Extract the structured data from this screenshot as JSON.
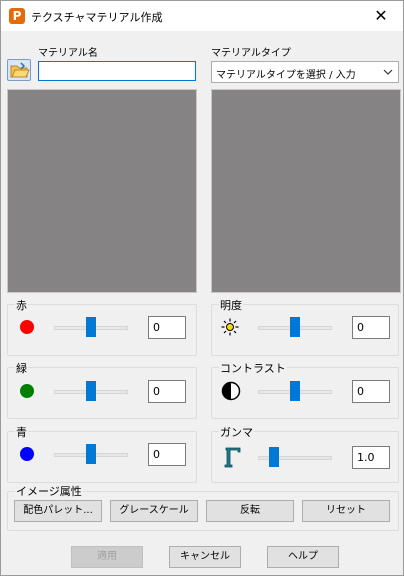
{
  "window": {
    "title": "テクスチャマテリアル作成",
    "close_glyph": "✕"
  },
  "material_name": {
    "label": "マテリアル名",
    "value": ""
  },
  "material_type": {
    "label": "マテリアルタイプ",
    "value": "マテリアルタイプを選択 / 入力"
  },
  "preview_color": "#858384",
  "color_groups": [
    {
      "label": "赤",
      "value": "0",
      "color": "#ff0000",
      "slider_position": 0.5
    },
    {
      "label": "緑",
      "value": "0",
      "color": "#008000",
      "slider_position": 0.5
    },
    {
      "label": "青",
      "value": "0",
      "color": "#0000ff",
      "slider_position": 0.5
    }
  ],
  "adjust_groups": [
    {
      "label": "明度",
      "value": "0",
      "icon": "brightness-icon",
      "slider_position": 0.5
    },
    {
      "label": "コントラスト",
      "value": "0",
      "icon": "contrast-icon",
      "slider_position": 0.5
    },
    {
      "label": "ガンマ",
      "value": "1.0",
      "icon": "gamma-icon",
      "slider_position": 0.22
    }
  ],
  "image_attributes": {
    "label": "イメージ属性",
    "buttons": [
      "配色パレット...",
      "グレースケール",
      "反転",
      "リセット"
    ]
  },
  "footer": {
    "apply": "適用",
    "cancel": "キャンセル",
    "help": "ヘルプ"
  },
  "accent_color": "#0078d7"
}
